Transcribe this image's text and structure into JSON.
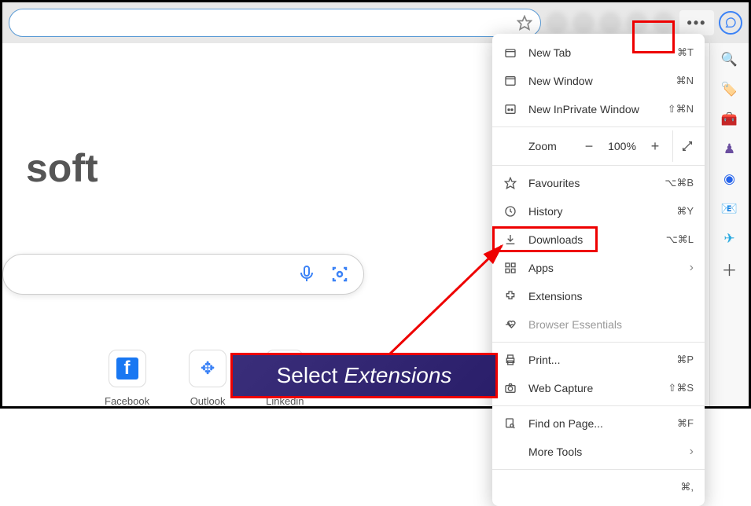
{
  "brand_fragment": "soft",
  "toolbar": {
    "more_glyph": "•••"
  },
  "menu": {
    "new_tab": "New Tab",
    "new_tab_sc": "⌘T",
    "new_win": "New Window",
    "new_win_sc": "⌘N",
    "new_inp": "New InPrivate Window",
    "new_inp_sc": "⇧⌘N",
    "zoom": "Zoom",
    "zoom_val": "100%",
    "fav": "Favourites",
    "fav_sc": "⌥⌘B",
    "hist": "History",
    "hist_sc": "⌘Y",
    "down": "Downloads",
    "down_sc": "⌥⌘L",
    "apps": "Apps",
    "ext": "Extensions",
    "ess": "Browser Essentials",
    "print": "Print...",
    "print_sc": "⌘P",
    "cap": "Web Capture",
    "cap_sc": "⇧⌘S",
    "find": "Find on Page...",
    "find_sc": "⌘F",
    "more": "More Tools",
    "cut_sc": "⌘,"
  },
  "quicklinks": {
    "fb": "Facebook",
    "ol": "Outlook",
    "li": "Linkedin"
  },
  "banner": {
    "a": "Select",
    "b": "Extensions"
  }
}
